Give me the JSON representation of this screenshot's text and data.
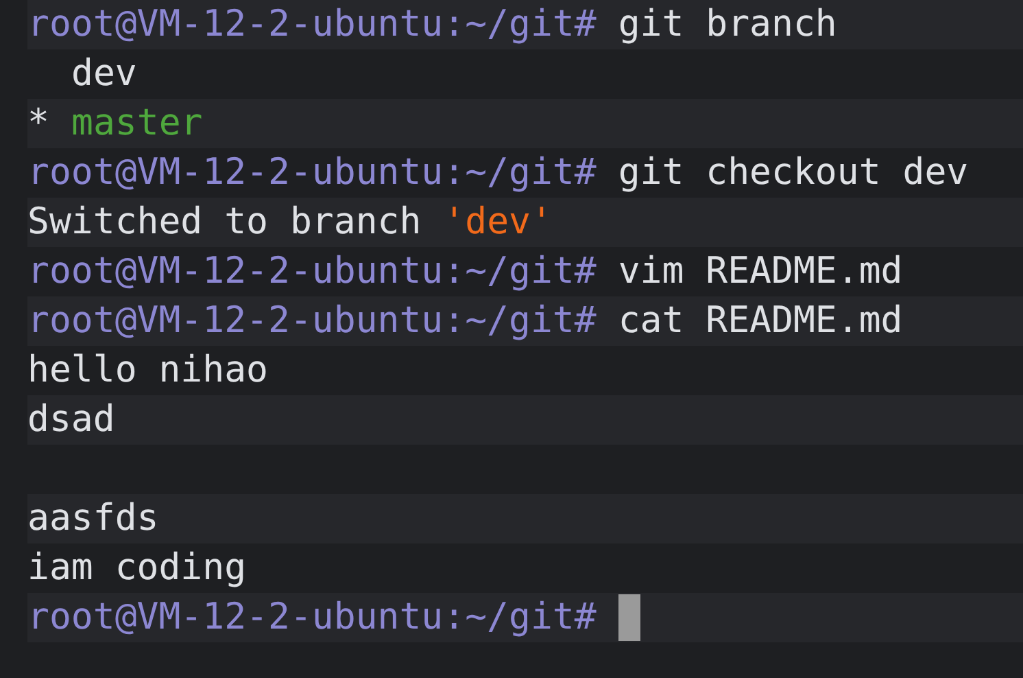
{
  "terminal": {
    "lines": [
      {
        "kind": "prompt",
        "prompt": "root@VM-12-2-ubuntu:~/git#",
        "command": "git branch"
      },
      {
        "kind": "branch",
        "name": "dev",
        "current": false
      },
      {
        "kind": "branch",
        "marker": "*",
        "name": "master",
        "current": true
      },
      {
        "kind": "prompt",
        "prompt": "root@VM-12-2-ubuntu:~/git#",
        "command": "git checkout dev"
      },
      {
        "kind": "message",
        "text": "Switched to branch",
        "highlight": "'dev'"
      },
      {
        "kind": "prompt",
        "prompt": "root@VM-12-2-ubuntu:~/git#",
        "command": "vim README.md"
      },
      {
        "kind": "prompt",
        "prompt": "root@VM-12-2-ubuntu:~/git#",
        "command": "cat README.md"
      },
      {
        "kind": "output",
        "text": "hello nihao"
      },
      {
        "kind": "output",
        "text": "dsad"
      },
      {
        "kind": "blank"
      },
      {
        "kind": "output",
        "text": "aasfds"
      },
      {
        "kind": "output",
        "text": "iam coding"
      },
      {
        "kind": "prompt",
        "prompt": "root@VM-12-2-ubuntu:~/git#",
        "cursor": true
      }
    ]
  }
}
